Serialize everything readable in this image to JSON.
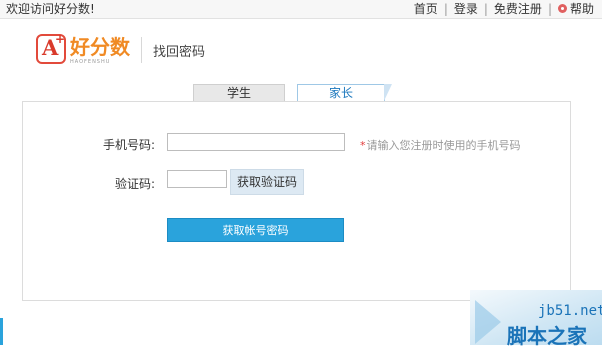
{
  "topbar": {
    "welcome": "欢迎访问好分数!",
    "links": [
      "首页",
      "登录",
      "免费注册",
      "帮助"
    ]
  },
  "header": {
    "logo_text": "好分数",
    "logo_sub": "HAOFENSHU",
    "title": "找回密码"
  },
  "tabs": [
    {
      "label": "学生",
      "active": false
    },
    {
      "label": "家长",
      "active": true
    }
  ],
  "form": {
    "phone_label": "手机号码:",
    "phone_value": "",
    "phone_hint_star": "*",
    "phone_hint": "请输入您注册时使用的手机号码",
    "code_label": "验证码:",
    "code_value": "",
    "get_code_button": "获取验证码",
    "submit_button": "获取帐号密码"
  },
  "watermark": {
    "line1": "jb51.net",
    "line2": "脚本之家"
  },
  "colors": {
    "accent_blue": "#2aa3dc",
    "tab_active_text": "#1a77bd",
    "logo_orange": "#f08a24",
    "logo_red": "#d93a2b",
    "required_star": "#e23b3b"
  }
}
